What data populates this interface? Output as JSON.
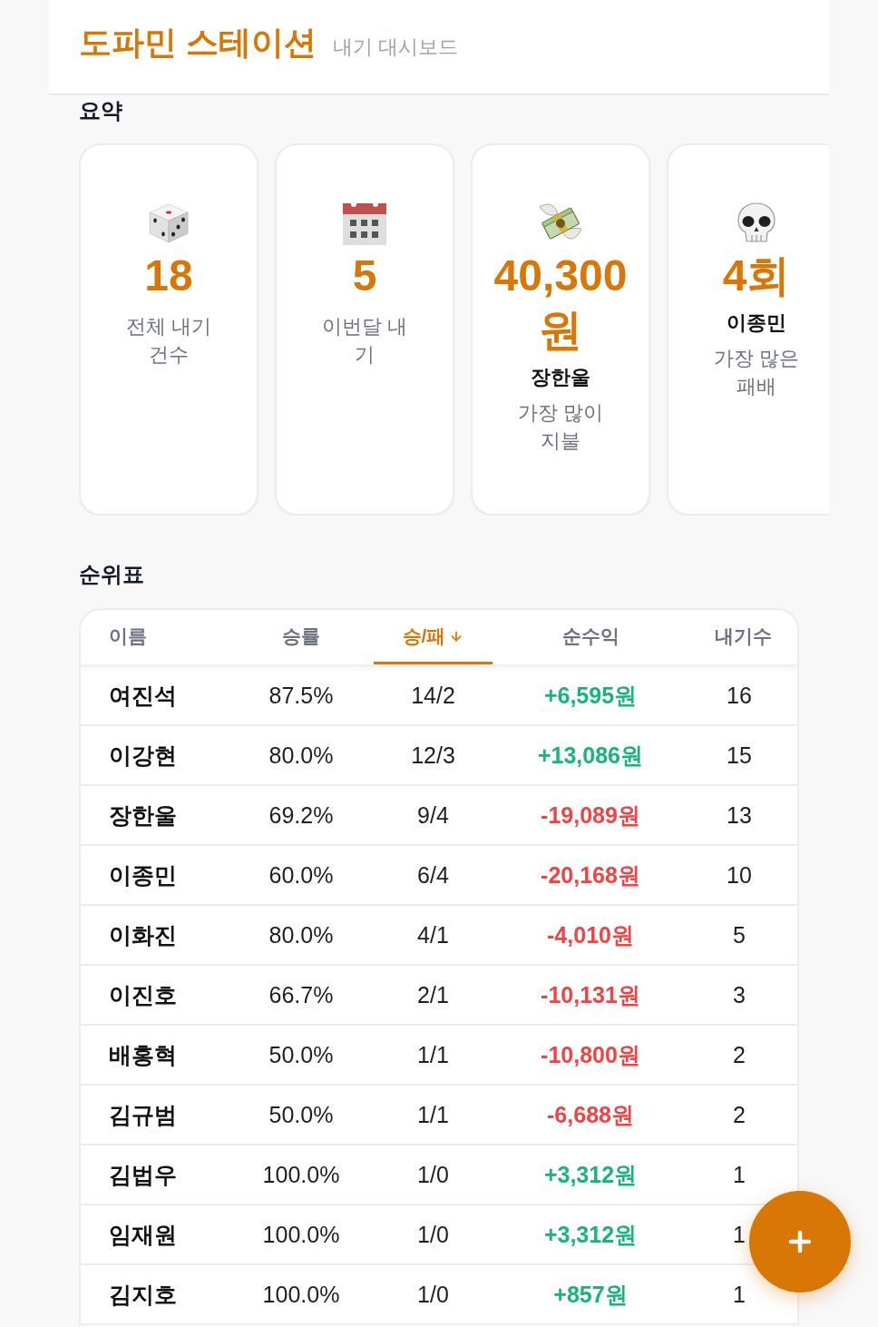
{
  "header": {
    "title": "도파민 스테이션",
    "subtitle": "내기 대시보드"
  },
  "summary": {
    "title": "요약",
    "cards": [
      {
        "kind": "total",
        "value": "18",
        "label": "전체 내기 건수"
      },
      {
        "kind": "month",
        "value": "5",
        "label": "이번달 내기"
      },
      {
        "kind": "payer",
        "value": "40,300",
        "unit": "원",
        "name": "장한울",
        "label": "가장 많이 지불"
      },
      {
        "kind": "loser",
        "value": "4",
        "unit": "회",
        "name": "이종민",
        "label": "가장 많은 패배"
      }
    ]
  },
  "leaderboard": {
    "title": "순위표",
    "columns": [
      {
        "label": "이름",
        "selected": false
      },
      {
        "label": "승률",
        "selected": false
      },
      {
        "label": "승/패",
        "selected": true
      },
      {
        "label": "순수익",
        "selected": false
      },
      {
        "label": "내기수",
        "selected": false
      }
    ],
    "rows": [
      {
        "name": "여진석",
        "win_rate": "87.5%",
        "record": "14/2",
        "net": "+6,595원",
        "positive": true,
        "bets": "16"
      },
      {
        "name": "이강현",
        "win_rate": "80.0%",
        "record": "12/3",
        "net": "+13,086원",
        "positive": true,
        "bets": "15"
      },
      {
        "name": "장한울",
        "win_rate": "69.2%",
        "record": "9/4",
        "net": "-19,089원",
        "positive": false,
        "bets": "13"
      },
      {
        "name": "이종민",
        "win_rate": "60.0%",
        "record": "6/4",
        "net": "-20,168원",
        "positive": false,
        "bets": "10"
      },
      {
        "name": "이화진",
        "win_rate": "80.0%",
        "record": "4/1",
        "net": "-4,010원",
        "positive": false,
        "bets": "5"
      },
      {
        "name": "이진호",
        "win_rate": "66.7%",
        "record": "2/1",
        "net": "-10,131원",
        "positive": false,
        "bets": "3"
      },
      {
        "name": "배홍혁",
        "win_rate": "50.0%",
        "record": "1/1",
        "net": "-10,800원",
        "positive": false,
        "bets": "2"
      },
      {
        "name": "김규범",
        "win_rate": "50.0%",
        "record": "1/1",
        "net": "-6,688원",
        "positive": false,
        "bets": "2"
      },
      {
        "name": "김법우",
        "win_rate": "100.0%",
        "record": "1/0",
        "net": "+3,312원",
        "positive": true,
        "bets": "1"
      },
      {
        "name": "임재원",
        "win_rate": "100.0%",
        "record": "1/0",
        "net": "+3,312원",
        "positive": true,
        "bets": "1"
      },
      {
        "name": "김지호",
        "win_rate": "100.0%",
        "record": "1/0",
        "net": "+857원",
        "positive": true,
        "bets": "1"
      }
    ]
  }
}
